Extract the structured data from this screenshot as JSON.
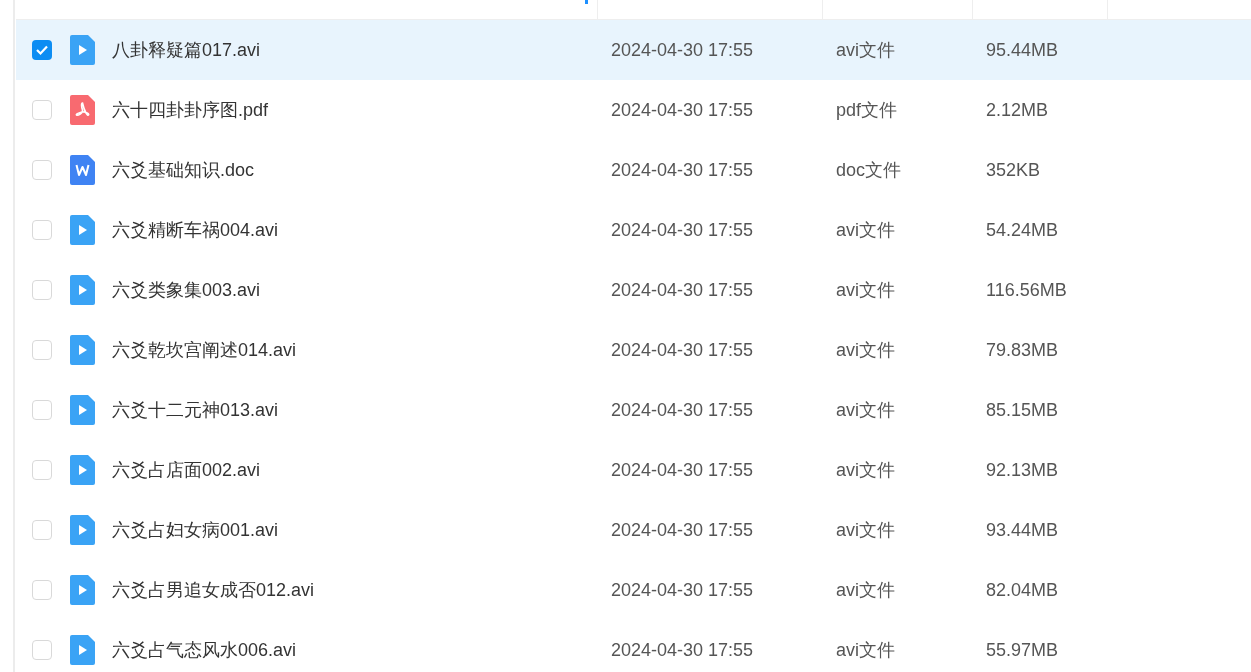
{
  "table": {
    "rows": [
      {
        "name": "八卦释疑篇017.avi",
        "modified": "2024-04-30 17:55",
        "type": "avi文件",
        "size": "95.44MB",
        "kind": "video",
        "selected": true
      },
      {
        "name": "六十四卦卦序图.pdf",
        "modified": "2024-04-30 17:55",
        "type": "pdf文件",
        "size": "2.12MB",
        "kind": "pdf",
        "selected": false
      },
      {
        "name": "六爻基础知识.doc",
        "modified": "2024-04-30 17:55",
        "type": "doc文件",
        "size": "352KB",
        "kind": "doc",
        "selected": false
      },
      {
        "name": "六爻精断车祸004.avi",
        "modified": "2024-04-30 17:55",
        "type": "avi文件",
        "size": "54.24MB",
        "kind": "video",
        "selected": false
      },
      {
        "name": "六爻类象集003.avi",
        "modified": "2024-04-30 17:55",
        "type": "avi文件",
        "size": "116.56MB",
        "kind": "video",
        "selected": false
      },
      {
        "name": "六爻乾坎宫阐述014.avi",
        "modified": "2024-04-30 17:55",
        "type": "avi文件",
        "size": "79.83MB",
        "kind": "video",
        "selected": false
      },
      {
        "name": "六爻十二元神013.avi",
        "modified": "2024-04-30 17:55",
        "type": "avi文件",
        "size": "85.15MB",
        "kind": "video",
        "selected": false
      },
      {
        "name": "六爻占店面002.avi",
        "modified": "2024-04-30 17:55",
        "type": "avi文件",
        "size": "92.13MB",
        "kind": "video",
        "selected": false
      },
      {
        "name": "六爻占妇女病001.avi",
        "modified": "2024-04-30 17:55",
        "type": "avi文件",
        "size": "93.44MB",
        "kind": "video",
        "selected": false
      },
      {
        "name": "六爻占男追女成否012.avi",
        "modified": "2024-04-30 17:55",
        "type": "avi文件",
        "size": "82.04MB",
        "kind": "video",
        "selected": false
      },
      {
        "name": "六爻占气态风水006.avi",
        "modified": "2024-04-30 17:55",
        "type": "avi文件",
        "size": "55.97MB",
        "kind": "video",
        "selected": false
      }
    ]
  }
}
